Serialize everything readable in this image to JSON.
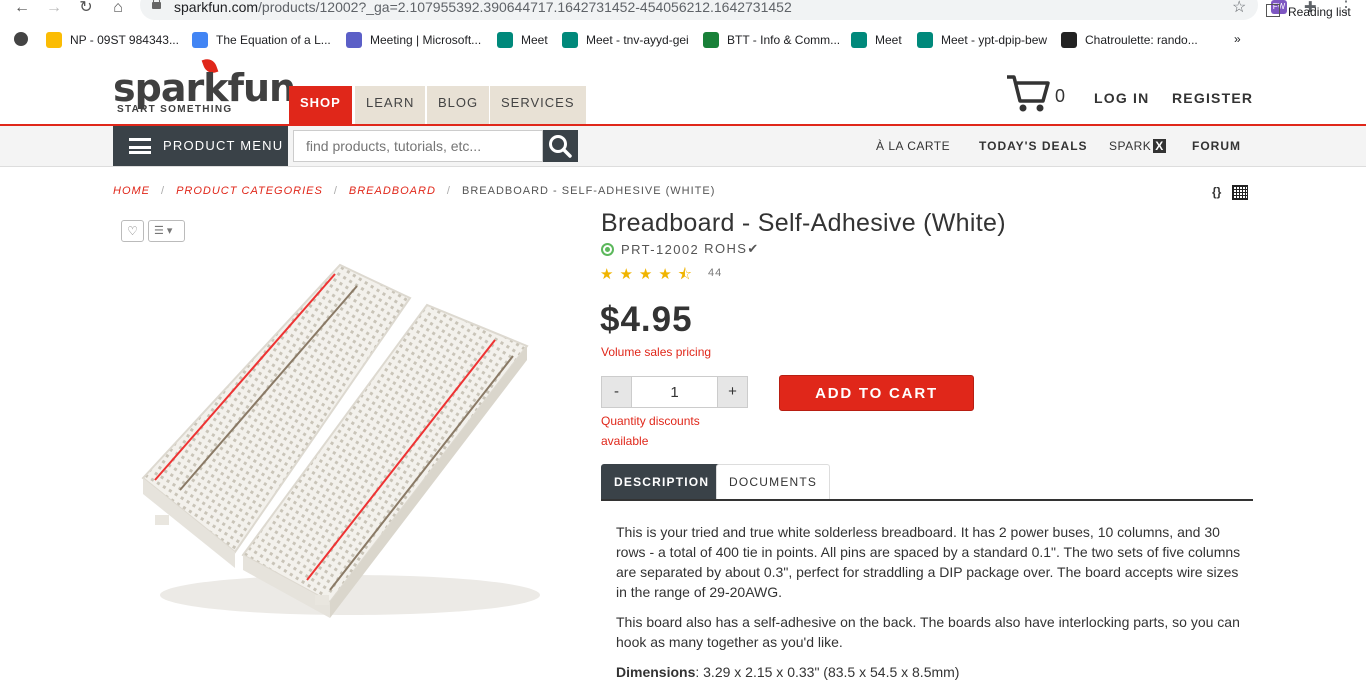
{
  "browser": {
    "url_host": "sparkfun.com",
    "url_rest": "/products/12002?_ga=2.107955392.390644717.1642731452-454056212.1642731452",
    "bookmarks": [
      {
        "label": "NP - 09ST 984343...",
        "color": "#fbbc04"
      },
      {
        "label": "The Equation of a L...",
        "color": "#4285f4"
      },
      {
        "label": "Meeting | Microsoft...",
        "color": "#5b5fc7"
      },
      {
        "label": "Meet",
        "color": "#00897b"
      },
      {
        "label": "Meet - tnv-ayyd-gei",
        "color": "#00897b"
      },
      {
        "label": "BTT - Info & Comm...",
        "color": "#188038"
      },
      {
        "label": "Meet",
        "color": "#00897b"
      },
      {
        "label": "Meet - ypt-dpip-bew",
        "color": "#00897b"
      },
      {
        "label": "Chatroulette: rando...",
        "color": "#222222"
      }
    ],
    "overflow": "»",
    "reading_list": "Reading list"
  },
  "header": {
    "logo_word": "sparkfun",
    "logo_tag": "START SOMETHING",
    "tabs": [
      "SHOP",
      "LEARN",
      "BLOG",
      "SERVICES"
    ],
    "cart_count": "0",
    "login": "LOG IN",
    "register": "REGISTER"
  },
  "subnav": {
    "product_menu": "PRODUCT MENU",
    "search_placeholder": "find products, tutorials, etc...",
    "links": [
      "À LA CARTE",
      "TODAY'S DEALS",
      "SPARK",
      "FORUM"
    ],
    "sparkx_x": "X"
  },
  "breadcrumb": {
    "items": [
      "HOME",
      "PRODUCT CATEGORIES",
      "BREADBOARD"
    ],
    "current": "BREADBOARD - SELF-ADHESIVE (WHITE)",
    "separator": "/"
  },
  "product": {
    "title": "Breadboard - Self-Adhesive (White)",
    "sku": "PRT-12002",
    "rohs": "ROHS✔",
    "rating": 4.5,
    "stars": "★★★★⯪",
    "review_count": "44",
    "price": "$4.95",
    "volume_pricing": "Volume sales pricing",
    "qty_minus": "-",
    "qty_plus": "+",
    "qty_value": "1",
    "add_to_cart": "ADD TO CART",
    "qty_discounts": "Quantity discounts available",
    "tabs": [
      "DESCRIPTION",
      "DOCUMENTS"
    ],
    "description": [
      "This is your tried and true white solderless breadboard. It has 2 power buses, 10 columns, and 30 rows - a total of 400 tie in points. All pins are spaced by a standard 0.1\". The two sets of five columns are separated by about 0.3\", perfect for straddling a DIP package over. The board accepts wire sizes in the range of 29-20AWG.",
      "This board also has a self-adhesive on the back. The boards also have interlocking parts, so you can hook as many together as you'd like."
    ],
    "dimensions_label": "Dimensions",
    "dimensions_value": ": 3.29 x 2.15 x 0.33\" (83.5 x 54.5 x 8.5mm)"
  },
  "colors": {
    "brand_red": "#e0271a",
    "dark": "#3a4248",
    "star": "#f0b400",
    "rohs_green": "#5cb85c"
  }
}
